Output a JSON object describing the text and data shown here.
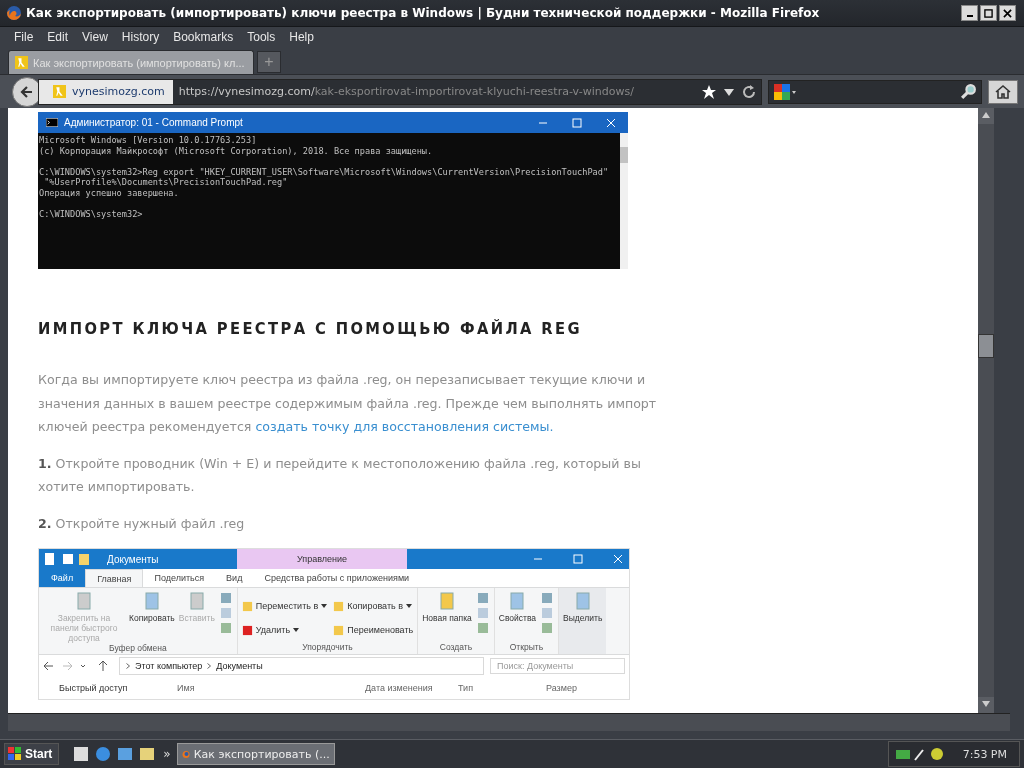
{
  "window": {
    "title": "Как экспортировать (импортировать) ключи реестра в Windows | Будни технической поддержки - Mozilla Firefox"
  },
  "menu": [
    "File",
    "Edit",
    "View",
    "History",
    "Bookmarks",
    "Tools",
    "Help"
  ],
  "tabs": [
    {
      "label": "Как экспортировать (импортировать) кл...",
      "selected": true
    }
  ],
  "new_tab": "+",
  "address_bar": {
    "site_badge": "vynesimozg.com",
    "url_host": "https://vynesimozg.com/",
    "url_path": "kak-eksportirovat-importirovat-klyuchi-reestra-v-windows/"
  },
  "article": {
    "cmd_window": {
      "title": "Администратор: 01 - Command Prompt",
      "blocks": [
        [
          "Microsoft Windows [Version 10.0.17763.253]",
          "(c) Корпорация Майкрософт (Microsoft Corporation), 2018. Все права защищены."
        ],
        [
          "C:\\WINDOWS\\system32>Reg export \"HKEY_CURRENT_USER\\Software\\Microsoft\\Windows\\CurrentVersion\\PrecisionTouchPad\"",
          " \"%UserProfile%\\Documents\\PrecisionTouchPad.reg\"",
          "Операция успешно завершена."
        ],
        [
          "C:\\WINDOWS\\system32>"
        ]
      ]
    },
    "heading": "ИМПОРТ КЛЮЧА РЕЕСТРА С ПОМОЩЬЮ ФАЙЛА REG",
    "paragraphs": [
      {
        "text": "Когда вы импортируете ключ реестра из файла .reg, он перезаписывает текущие ключи и значения данных в вашем реестре содержимым файла .reg. Прежде чем выполнять импорт ключей реестра рекомендуется ",
        "link": "создать точку для восстановления системы."
      },
      {
        "text": "**1.** Откройте проводник (Win + E) и перейдите к местоположению файла .reg, который вы хотите импортировать."
      },
      {
        "text": "**2.** Откройте нужный файл .reg"
      }
    ],
    "explorer_window": {
      "title": "Документы",
      "context_tab": "Управление",
      "ribbon_tabs": [
        {
          "label": "Файл",
          "kind": "file",
          "selected": false
        },
        {
          "label": "Главная",
          "kind": "tab",
          "selected": true
        },
        {
          "label": "Поделиться",
          "kind": "tab",
          "selected": false
        },
        {
          "label": "Вид",
          "kind": "tab",
          "selected": false
        },
        {
          "label": "Средства работы с приложениями",
          "kind": "tab",
          "selected": false
        }
      ],
      "ribbon_groups": [
        {
          "label": "Буфер обмена",
          "commands": [
            {
              "kind": "large",
              "label": "Закрепить на панели быстрого доступа",
              "disabled": true
            },
            {
              "kind": "large",
              "label": "Копировать",
              "disabled": false
            },
            {
              "kind": "large",
              "label": "Вставить",
              "disabled": true
            },
            {
              "kind": "icons"
            }
          ]
        },
        {
          "label": "Упорядочить",
          "commands": [
            {
              "kind": "small",
              "label": "Переместить в",
              "dropdown": true
            },
            {
              "kind": "small",
              "label": "Копировать в",
              "dropdown": true
            },
            {
              "kind": "small",
              "label": "Удалить",
              "dropdown": true
            },
            {
              "kind": "small",
              "label": "Переименовать",
              "dropdown": false
            }
          ]
        },
        {
          "label": "Создать",
          "commands": [
            {
              "kind": "large",
              "label": "Новая папка",
              "disabled": false
            },
            {
              "kind": "icons"
            }
          ]
        },
        {
          "label": "Открыть",
          "commands": [
            {
              "kind": "large",
              "label": "Свойства",
              "disabled": false
            },
            {
              "kind": "icons"
            }
          ]
        },
        {
          "commands": [
            {
              "kind": "large",
              "label": "Выделить",
              "disabled": false
            }
          ]
        }
      ],
      "breadcrumb": [
        "Этот компьютер",
        "Документы"
      ],
      "search": {
        "placeholder": "Поиск: Документы"
      },
      "columns": [
        "Имя",
        "Дата изменения",
        "Тип",
        "Размер"
      ],
      "nav_item": "Быстрый доступ"
    }
  },
  "taskbar": {
    "start": "Start",
    "more": "»",
    "task": "Как экспортировать (...",
    "clock": "7:53 PM"
  }
}
